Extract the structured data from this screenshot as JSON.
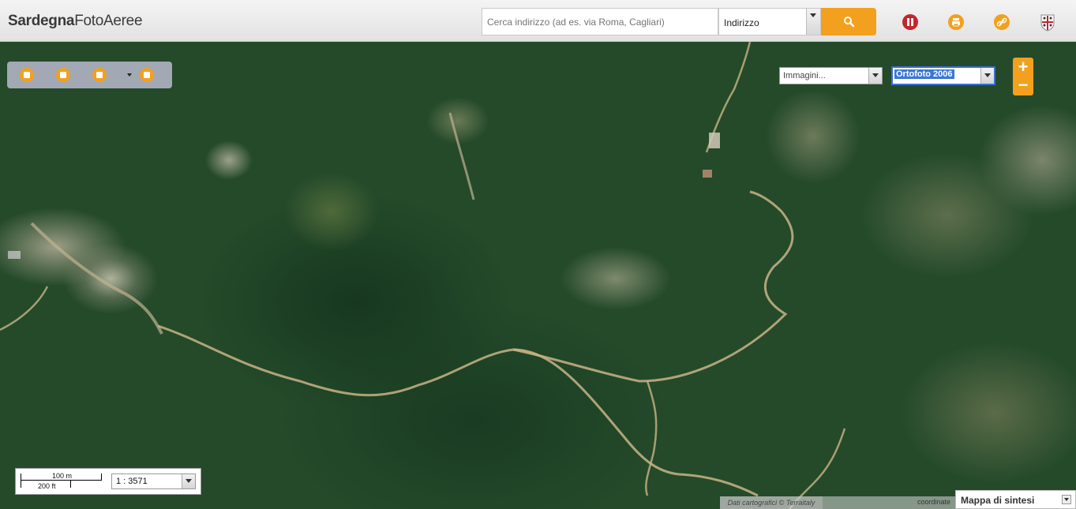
{
  "header": {
    "logo_bold": "Sardegna",
    "logo_regular": "FotoAeree",
    "search_placeholder": "Cerca indirizzo (ad es. via Roma, Cagliari)",
    "search_type": "Indirizzo",
    "icons": [
      "search-icon",
      "pause-icon",
      "print-icon",
      "link-icon",
      "sardinia-crest-icon"
    ]
  },
  "toolbar": {
    "tools": [
      "zoom-extent-icon",
      "zoom-box-icon",
      "measure-icon",
      "layers-dome-icon"
    ]
  },
  "layers": {
    "images_select": "Immagini...",
    "ortho_select": "Ortofoto 2006"
  },
  "zoom": {
    "plus": "+",
    "minus": "−"
  },
  "scale": {
    "metric_label": "100 m",
    "imperial_label": "200 ft",
    "ratio": "1 : 3571"
  },
  "footer": {
    "attribution": "Dati cartografici © Terraitaly",
    "coordinates_label": "coordinate",
    "overview_label": "Mappa di sintesi"
  },
  "colors": {
    "accent": "#f2a01e",
    "forest": "#244a2a",
    "road": "#c9b486",
    "pause_icon": "#c0262d"
  }
}
